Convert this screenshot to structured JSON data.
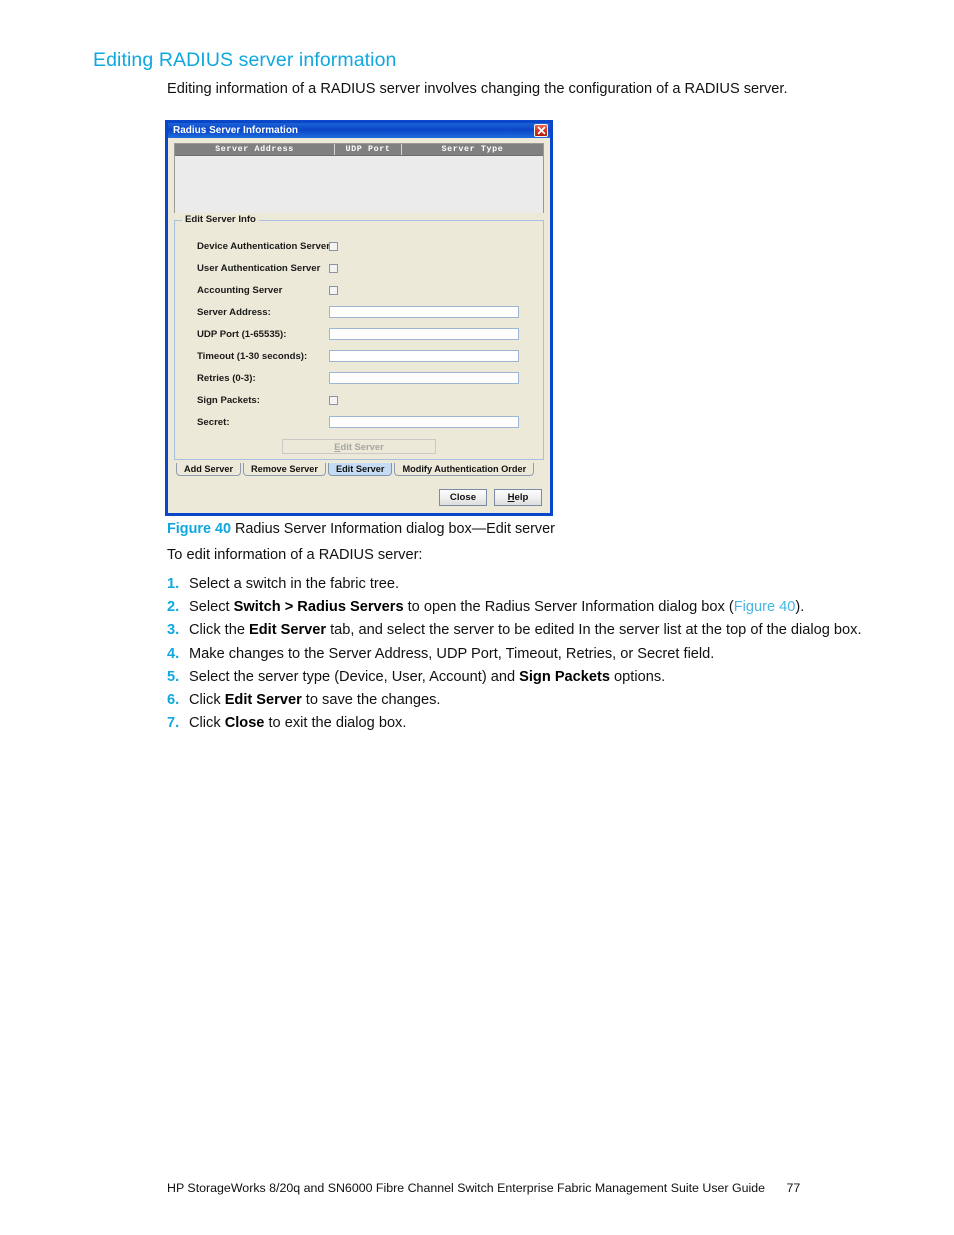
{
  "page": {
    "heading": "Editing RADIUS server information",
    "intro": "Editing information of a RADIUS server involves changing the configuration of a RADIUS server.",
    "lead_in": "To edit information of a RADIUS server:",
    "accent_color": "#0FA8DE",
    "link_color": "#46B6E5"
  },
  "dialog": {
    "title": "Radius Server Information",
    "close_icon": "close-icon",
    "titlebar_color": "#0A46C8",
    "close_button_color": "#D83A22",
    "list": {
      "columns": [
        "Server Address",
        "UDP Port",
        "Server Type"
      ],
      "rows": []
    },
    "group": {
      "title": "Edit Server Info",
      "fields": [
        {
          "label": "Device Authentication Server",
          "type": "checkbox",
          "checked": false
        },
        {
          "label": "User Authentication Server",
          "type": "checkbox",
          "checked": false
        },
        {
          "label": "Accounting Server",
          "type": "checkbox",
          "checked": false
        },
        {
          "label": "Server Address:",
          "type": "text",
          "value": "",
          "placeholder": ""
        },
        {
          "label": "UDP Port (1-65535):",
          "type": "text",
          "value": "",
          "placeholder": ""
        },
        {
          "label": "Timeout (1-30 seconds):",
          "type": "text",
          "value": "",
          "placeholder": ""
        },
        {
          "label": "Retries (0-3):",
          "type": "text",
          "value": "",
          "placeholder": ""
        },
        {
          "label": "Sign Packets:",
          "type": "checkbox",
          "checked": false
        },
        {
          "label": "Secret:",
          "type": "text",
          "value": "",
          "placeholder": ""
        }
      ],
      "action_button": {
        "label": "Edit Server",
        "mnemonic": "E",
        "enabled": false
      }
    },
    "tabs": [
      {
        "label": "Add Server",
        "active": false
      },
      {
        "label": "Remove Server",
        "active": false
      },
      {
        "label": "Edit Server",
        "active": true
      },
      {
        "label": "Modify Authentication Order",
        "active": false
      }
    ],
    "buttons": [
      {
        "label": "Close",
        "mnemonic": ""
      },
      {
        "label": "Help",
        "mnemonic": "H"
      }
    ]
  },
  "figure": {
    "number": "Figure 40",
    "caption": "Radius Server Information dialog box—Edit server"
  },
  "steps": [
    {
      "num": "1.",
      "html": "Select a switch in the fabric tree."
    },
    {
      "num": "2.",
      "html": "Select <b>Switch &gt; Radius Servers</b> to open the Radius Server Information dialog box (<span class=\"link\">Figure 40</span>)."
    },
    {
      "num": "3.",
      "html": "Click the <b>Edit Server</b> tab, and select the server to be edited In the server list at the top of the dialog box."
    },
    {
      "num": "4.",
      "html": "Make changes to the Server Address, UDP Port, Timeout, Retries, or Secret field."
    },
    {
      "num": "5.",
      "html": "Select the server type (Device, User, Account) and <b>Sign Packets</b> options."
    },
    {
      "num": "6.",
      "html": "Click <b>Edit Server</b> to save the changes."
    },
    {
      "num": "7.",
      "html": "Click <b>Close</b> to exit the dialog box."
    }
  ],
  "footer": {
    "text": "HP StorageWorks 8/20q and SN6000 Fibre Channel Switch Enterprise Fabric Management Suite User Guide",
    "page_number": "77"
  }
}
